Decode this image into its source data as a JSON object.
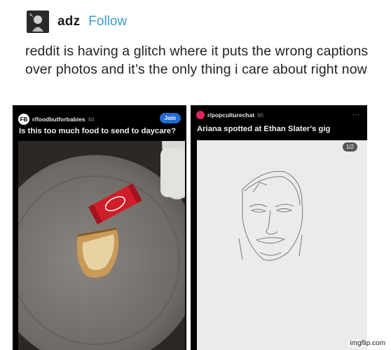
{
  "post": {
    "username": "adz",
    "follow_label": "Follow",
    "text": "reddit is having a glitch where it puts the wrong captions over photos and it’s the only thing i care about right now"
  },
  "left_panel": {
    "subreddit": "r/foodbutforbabies",
    "age": "4d",
    "join_label": "Join",
    "caption": "Is this too much food to send to daycare?",
    "icon_text": "FB"
  },
  "right_panel": {
    "subreddit": "r/popculturechat",
    "age": "6h",
    "more_label": "...",
    "caption": "Ariana spotted at Ethan Slater's gig",
    "pager": "1/2"
  },
  "watermark": "imgflip.com"
}
